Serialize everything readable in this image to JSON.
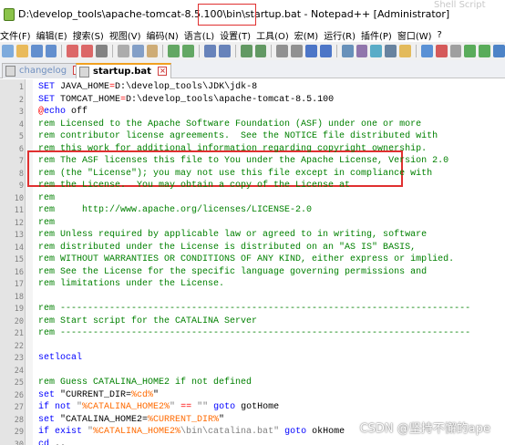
{
  "window": {
    "title_path": "D:\\develop_tools\\apache-tomcat-8.5.100\\bin\\",
    "title_file": "startup.bat",
    "title_sep": " - ",
    "title_app": "Notepad++ [Administrator]",
    "ghost_right": "Shell Script"
  },
  "menu": [
    "文件(F)",
    "编辑(E)",
    "搜索(S)",
    "视图(V)",
    "编码(N)",
    "语言(L)",
    "设置(T)",
    "工具(O)",
    "宏(M)",
    "运行(R)",
    "插件(P)",
    "窗口(W)",
    "?"
  ],
  "toolbar_icons": [
    "new-icon",
    "open-icon",
    "save-icon",
    "save-all-icon",
    "close-icon",
    "close-all-icon",
    "print-icon",
    "cut-icon",
    "copy-icon",
    "paste-icon",
    "undo-icon",
    "redo-icon",
    "find-icon",
    "replace-icon",
    "zoom-in-icon",
    "zoom-out-icon",
    "sync-v-icon",
    "sync-h-icon",
    "wrap-icon",
    "all-chars-icon",
    "indent-guide-icon",
    "udl-icon",
    "doc-map-icon",
    "func-list-icon",
    "folder-icon",
    "monitor-icon",
    "record-icon",
    "stop-icon",
    "play-icon",
    "play-multi-icon",
    "save-macro-icon"
  ],
  "tabs": [
    {
      "label": "changelog",
      "active": false
    },
    {
      "label": "startup.bat",
      "active": true
    }
  ],
  "lines": [
    {
      "n": "1",
      "parts": [
        {
          "t": "kw",
          "v": "SET "
        },
        {
          "t": "",
          "v": "JAVA_HOME"
        },
        {
          "t": "op",
          "v": "="
        },
        {
          "t": "",
          "v": "D:\\develop_tools\\JDK\\jdk-8"
        }
      ]
    },
    {
      "n": "2",
      "parts": [
        {
          "t": "kw",
          "v": "SET "
        },
        {
          "t": "",
          "v": "TOMCAT_HOME"
        },
        {
          "t": "op",
          "v": "="
        },
        {
          "t": "",
          "v": "D:\\develop_tools\\apache-tomcat-8.5.100"
        }
      ]
    },
    {
      "n": "3",
      "parts": [
        {
          "t": "op",
          "v": "@"
        },
        {
          "t": "kw",
          "v": "echo"
        },
        {
          "t": "",
          "v": " off"
        }
      ]
    },
    {
      "n": "4",
      "parts": [
        {
          "t": "cm",
          "v": "rem Licensed to the Apache Software Foundation (ASF) under one or more"
        }
      ]
    },
    {
      "n": "5",
      "parts": [
        {
          "t": "cm",
          "v": "rem contributor license agreements.  See the NOTICE file distributed with"
        }
      ]
    },
    {
      "n": "6",
      "parts": [
        {
          "t": "cm",
          "v": "rem this work for additional information regarding copyright ownership."
        }
      ]
    },
    {
      "n": "7",
      "parts": [
        {
          "t": "cm",
          "v": "rem The ASF licenses this file to You under the Apache License, Version 2.0"
        }
      ]
    },
    {
      "n": "8",
      "parts": [
        {
          "t": "cm",
          "v": "rem (the \"License\"); you may not use this file except in compliance with"
        }
      ]
    },
    {
      "n": "9",
      "parts": [
        {
          "t": "cm",
          "v": "rem the License.  You may obtain a copy of the License at"
        }
      ]
    },
    {
      "n": "10",
      "parts": [
        {
          "t": "cm",
          "v": "rem"
        }
      ]
    },
    {
      "n": "11",
      "parts": [
        {
          "t": "cm",
          "v": "rem     http://www.apache.org/licenses/LICENSE-2.0"
        }
      ]
    },
    {
      "n": "12",
      "parts": [
        {
          "t": "cm",
          "v": "rem"
        }
      ]
    },
    {
      "n": "13",
      "parts": [
        {
          "t": "cm",
          "v": "rem Unless required by applicable law or agreed to in writing, software"
        }
      ]
    },
    {
      "n": "14",
      "parts": [
        {
          "t": "cm",
          "v": "rem distributed under the License is distributed on an \"AS IS\" BASIS,"
        }
      ]
    },
    {
      "n": "15",
      "parts": [
        {
          "t": "cm",
          "v": "rem WITHOUT WARRANTIES OR CONDITIONS OF ANY KIND, either express or implied."
        }
      ]
    },
    {
      "n": "16",
      "parts": [
        {
          "t": "cm",
          "v": "rem See the License for the specific language governing permissions and"
        }
      ]
    },
    {
      "n": "17",
      "parts": [
        {
          "t": "cm",
          "v": "rem limitations under the License."
        }
      ]
    },
    {
      "n": "18",
      "parts": []
    },
    {
      "n": "19",
      "parts": [
        {
          "t": "cm",
          "v": "rem ---------------------------------------------------------------------------"
        }
      ]
    },
    {
      "n": "20",
      "parts": [
        {
          "t": "cm",
          "v": "rem Start script for the CATALINA Server"
        }
      ]
    },
    {
      "n": "21",
      "parts": [
        {
          "t": "cm",
          "v": "rem ---------------------------------------------------------------------------"
        }
      ]
    },
    {
      "n": "22",
      "parts": []
    },
    {
      "n": "23",
      "parts": [
        {
          "t": "kw",
          "v": "setlocal"
        }
      ]
    },
    {
      "n": "24",
      "parts": []
    },
    {
      "n": "25",
      "parts": [
        {
          "t": "cm",
          "v": "rem Guess CATALINA_HOME2 if not defined"
        }
      ]
    },
    {
      "n": "26",
      "parts": [
        {
          "t": "kw",
          "v": "set "
        },
        {
          "t": "",
          "v": "\"CURRENT_DIR="
        },
        {
          "t": "var",
          "v": "%cd%"
        },
        {
          "t": "",
          "v": "\""
        }
      ]
    },
    {
      "n": "27",
      "parts": [
        {
          "t": "kw",
          "v": "if not "
        },
        {
          "t": "str",
          "v": "\""
        },
        {
          "t": "var",
          "v": "%CATALINA_HOME2%"
        },
        {
          "t": "str",
          "v": "\""
        },
        {
          "t": "",
          "v": " "
        },
        {
          "t": "op",
          "v": "=="
        },
        {
          "t": "",
          "v": " "
        },
        {
          "t": "str",
          "v": "\"\""
        },
        {
          "t": "",
          "v": " "
        },
        {
          "t": "kw",
          "v": "goto"
        },
        {
          "t": "",
          "v": " gotHome"
        }
      ]
    },
    {
      "n": "28",
      "parts": [
        {
          "t": "kw",
          "v": "set "
        },
        {
          "t": "",
          "v": "\"CATALINA_HOME2="
        },
        {
          "t": "var",
          "v": "%CURRENT_DIR%"
        },
        {
          "t": "",
          "v": "\""
        }
      ]
    },
    {
      "n": "29",
      "parts": [
        {
          "t": "kw",
          "v": "if exist "
        },
        {
          "t": "str",
          "v": "\""
        },
        {
          "t": "var",
          "v": "%CATALINA_HOME2%"
        },
        {
          "t": "str",
          "v": "\\bin\\catalina.bat\""
        },
        {
          "t": "",
          "v": " "
        },
        {
          "t": "kw",
          "v": "goto"
        },
        {
          "t": "",
          "v": " okHome"
        }
      ]
    },
    {
      "n": "30",
      "parts": [
        {
          "t": "kw",
          "v": "cd "
        },
        {
          "t": "",
          "v": ".."
        }
      ]
    }
  ],
  "watermark": "CSDN @坚持不懈的ape"
}
